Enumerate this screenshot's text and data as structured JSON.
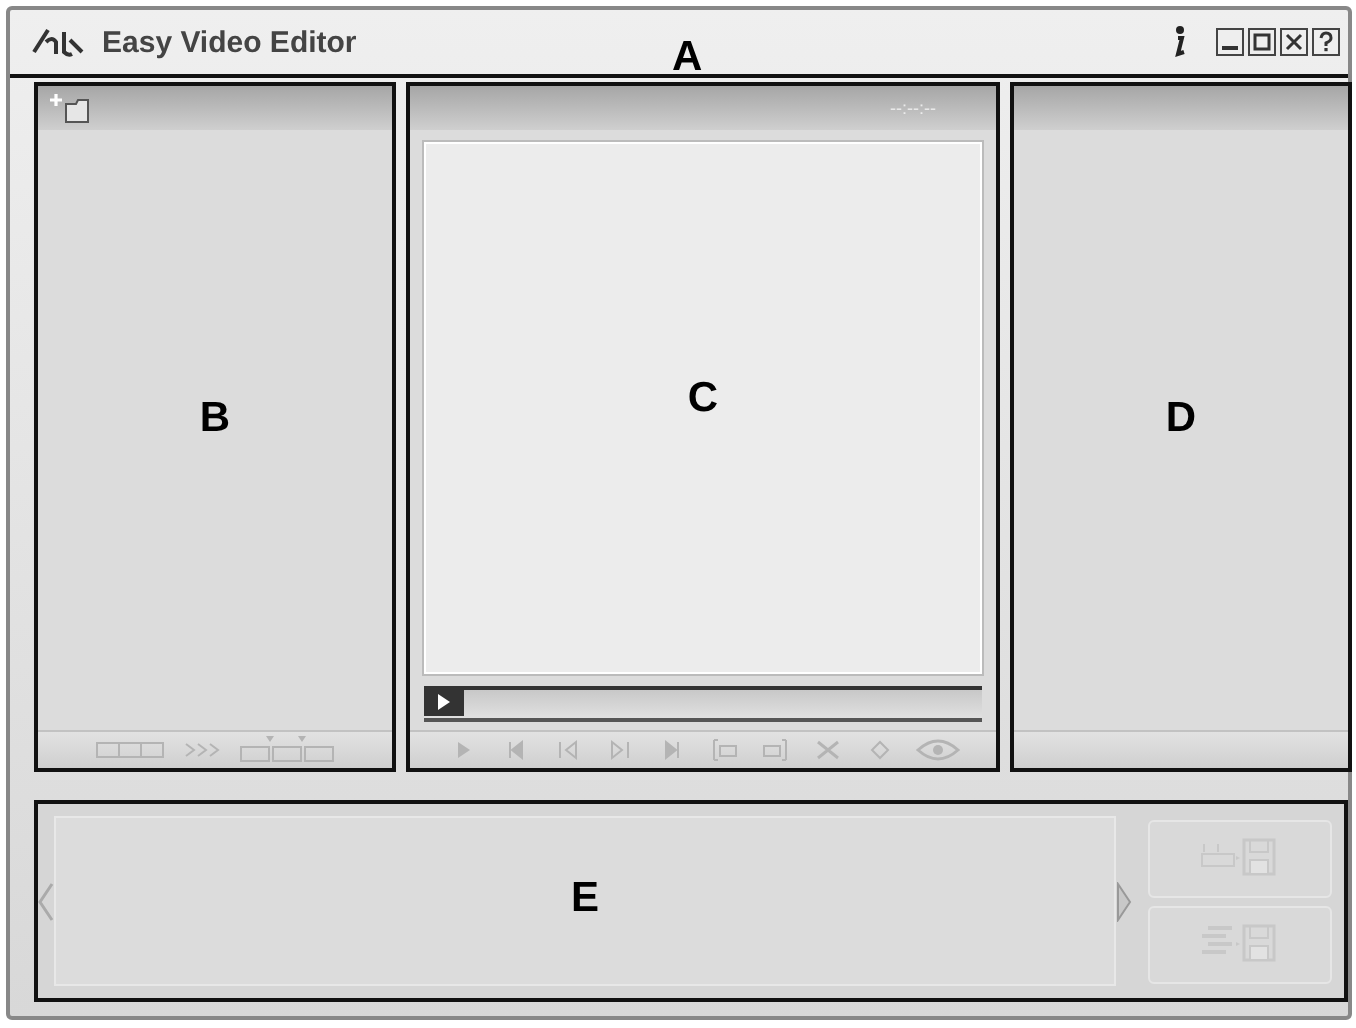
{
  "window": {
    "title": "Easy Video Editor"
  },
  "callouts": {
    "title": "A",
    "library": "B",
    "preview": "C",
    "properties": "D",
    "timeline": "E"
  },
  "preview": {
    "timecode": "--:--:--",
    "progress": {
      "level": 0
    }
  }
}
